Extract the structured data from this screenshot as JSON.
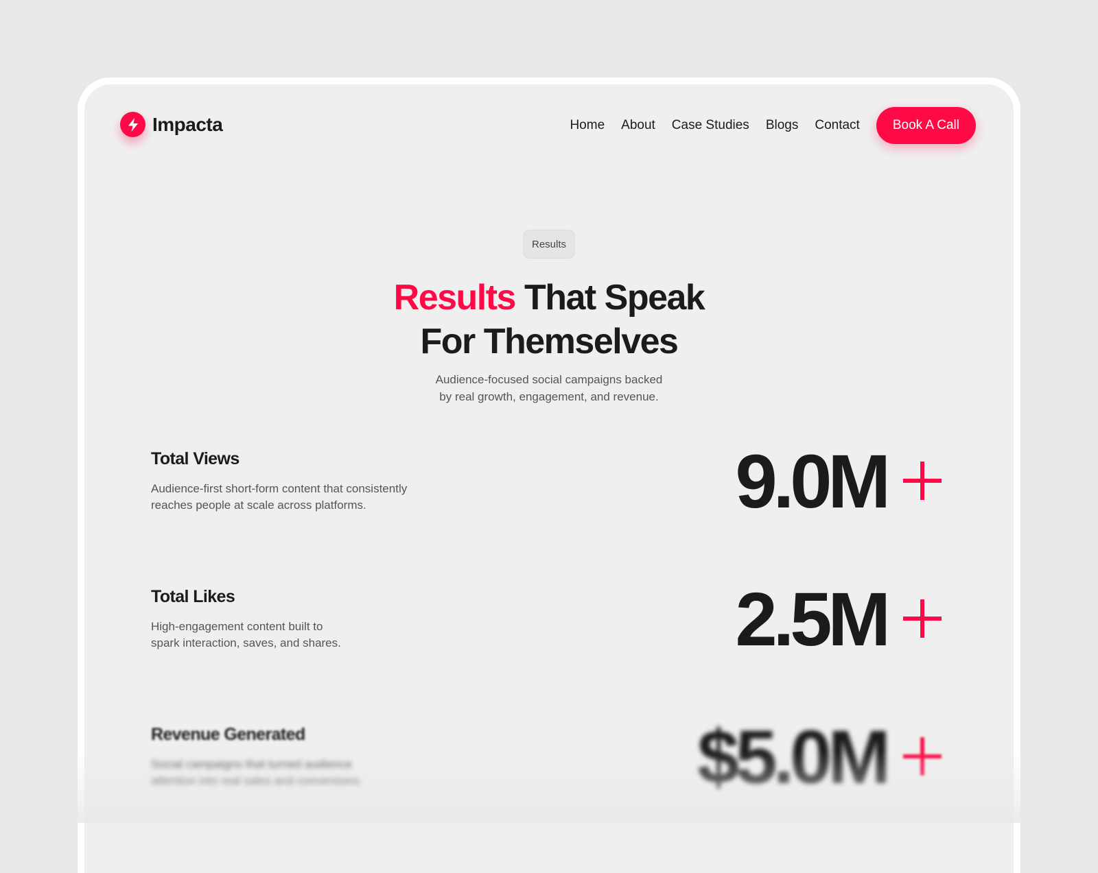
{
  "brand": {
    "name": "Impacta",
    "accent_color": "#ff0a47",
    "icon": "lightning-bolt-icon"
  },
  "nav": {
    "links": [
      "Home",
      "About",
      "Case Studies",
      "Blogs",
      "Contact"
    ],
    "cta_label": "Book A Call"
  },
  "hero": {
    "badge": "Results",
    "title_accent": "Results",
    "title_rest_line1": "That Speak",
    "title_line2": "For Themselves",
    "subtitle_line1": "Audience-focused social campaigns backed",
    "subtitle_line2": "by real growth, engagement, and revenue."
  },
  "stats": [
    {
      "title": "Total Views",
      "desc_line1": "Audience-first short-form content that consistently",
      "desc_line2": "reaches people at scale across platforms.",
      "value": "9.0M",
      "suffix": "+"
    },
    {
      "title": "Total Likes",
      "desc_line1": "High-engagement content built to",
      "desc_line2": "spark interaction, saves, and shares.",
      "value": "2.5M",
      "suffix": "+"
    },
    {
      "title": "Revenue Generated",
      "desc_line1": "Social campaigns that turned audience",
      "desc_line2": "attention into real sales and conversions.",
      "value": "$5.0M",
      "suffix": "+"
    }
  ]
}
